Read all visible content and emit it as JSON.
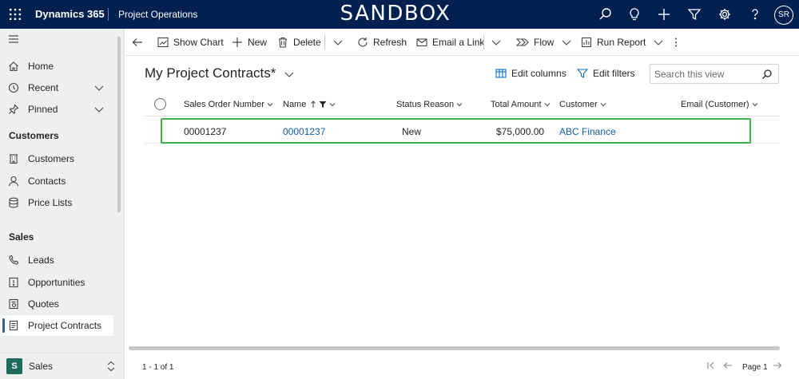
{
  "topbar": {
    "brand": "Dynamics 365",
    "app_name": "Project Operations",
    "environment": "SANDBOX",
    "avatar_initials": "SR",
    "bg_color": "#002050"
  },
  "sidebar": {
    "items": [
      {
        "label": "Home",
        "icon": "home-icon"
      },
      {
        "label": "Recent",
        "icon": "clock-icon"
      },
      {
        "label": "Pinned",
        "icon": "pin-icon"
      }
    ],
    "groups": [
      {
        "title": "Customers",
        "items": [
          {
            "label": "Customers",
            "icon": "building-icon"
          },
          {
            "label": "Contacts",
            "icon": "person-icon"
          },
          {
            "label": "Price Lists",
            "icon": "database-icon"
          }
        ]
      },
      {
        "title": "Sales",
        "items": [
          {
            "label": "Leads",
            "icon": "phone-person-icon"
          },
          {
            "label": "Opportunities",
            "icon": "opportunity-icon"
          },
          {
            "label": "Quotes",
            "icon": "quote-icon"
          },
          {
            "label": "Project Contracts",
            "icon": "document-icon",
            "active": true
          }
        ]
      }
    ],
    "area": {
      "badge": "S",
      "label": "Sales"
    }
  },
  "commandbar": {
    "show_chart": "Show Chart",
    "new": "New",
    "delete": "Delete",
    "refresh": "Refresh",
    "email_link": "Email a Link",
    "flow": "Flow",
    "run_report": "Run Report"
  },
  "view": {
    "title": "My Project Contracts*",
    "edit_columns": "Edit columns",
    "edit_filters": "Edit filters",
    "search_placeholder": "Search this view"
  },
  "grid": {
    "columns": [
      "Sales Order Number",
      "Name",
      "Status Reason",
      "Total Amount",
      "Customer",
      "Email (Customer)"
    ],
    "rows": [
      {
        "sales_order_number": "00001237",
        "name": "00001237",
        "status_reason": "New",
        "total_amount": "$75,000.00",
        "customer": "ABC Finance",
        "email": ""
      }
    ],
    "highlight_color": "#3fb04b",
    "link_color": "#115ea3"
  },
  "footer": {
    "record_count": "1 - 1 of 1",
    "page_label": "Page 1"
  }
}
